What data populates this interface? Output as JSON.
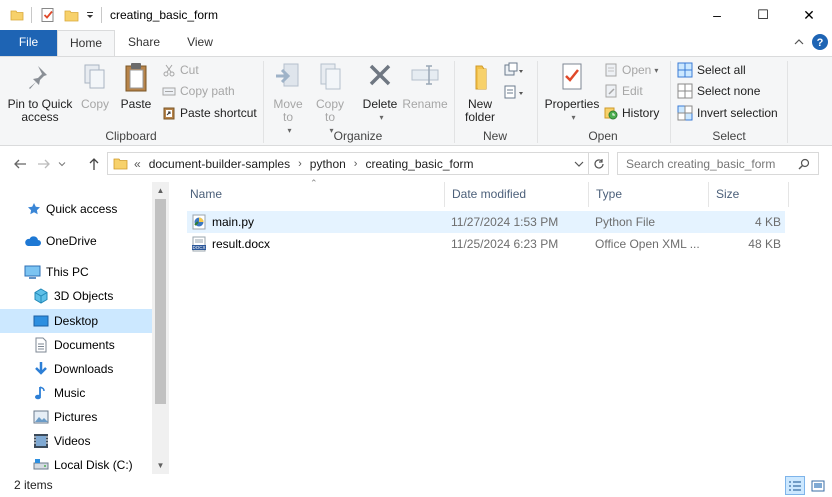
{
  "window": {
    "title": "creating_basic_form",
    "minimize": "–",
    "maximize": "☐",
    "close": "✕"
  },
  "ribbon_tabs": [
    {
      "label": "File"
    },
    {
      "label": "Home"
    },
    {
      "label": "Share"
    },
    {
      "label": "View"
    }
  ],
  "ribbon": {
    "clipboard": {
      "label": "Clipboard",
      "pin_to_quick_access": "Pin to Quick access",
      "copy": "Copy",
      "paste": "Paste",
      "cut": "Cut",
      "copy_path": "Copy path",
      "paste_shortcut": "Paste shortcut"
    },
    "organize": {
      "label": "Organize",
      "move_to": "Move to",
      "copy_to": "Copy to",
      "delete": "Delete",
      "rename": "Rename"
    },
    "new": {
      "label": "New",
      "new_folder": "New folder"
    },
    "open": {
      "label": "Open",
      "properties": "Properties",
      "open": "Open",
      "edit": "Edit",
      "history": "History"
    },
    "select": {
      "label": "Select",
      "select_all": "Select all",
      "select_none": "Select none",
      "invert_selection": "Invert selection"
    }
  },
  "address": {
    "overflow": "«",
    "breadcrumbs": [
      "document-builder-samples",
      "python",
      "creating_basic_form"
    ],
    "search_placeholder": "Search creating_basic_form"
  },
  "nav_pane": {
    "items": [
      {
        "label": "Quick access",
        "icon": "star-icon"
      },
      {
        "label": "OneDrive",
        "icon": "cloud-icon"
      },
      {
        "label": "This PC",
        "icon": "computer-icon"
      },
      {
        "label": "3D Objects",
        "icon": "cube-icon"
      },
      {
        "label": "Desktop",
        "icon": "desktop-icon",
        "selected": true
      },
      {
        "label": "Documents",
        "icon": "document-icon"
      },
      {
        "label": "Downloads",
        "icon": "download-icon"
      },
      {
        "label": "Music",
        "icon": "music-icon"
      },
      {
        "label": "Pictures",
        "icon": "pictures-icon"
      },
      {
        "label": "Videos",
        "icon": "video-icon"
      },
      {
        "label": "Local Disk (C:)",
        "icon": "disk-icon"
      }
    ]
  },
  "file_list": {
    "columns": [
      "Name",
      "Date modified",
      "Type",
      "Size"
    ],
    "rows": [
      {
        "name": "main.py",
        "date": "11/27/2024 1:53 PM",
        "type": "Python File",
        "size": "4 KB",
        "icon": "python-file-icon",
        "selected": true
      },
      {
        "name": "result.docx",
        "date": "11/25/2024 6:23 PM",
        "type": "Office Open XML ...",
        "size": "48 KB",
        "icon": "docx-file-icon"
      }
    ]
  },
  "status": {
    "item_count": "2 items"
  },
  "colors": {
    "file_tab": "#1e64b4",
    "selection": "#cce8ff",
    "row_hover": "#e5f3ff",
    "column_header_text": "#4c607a"
  }
}
